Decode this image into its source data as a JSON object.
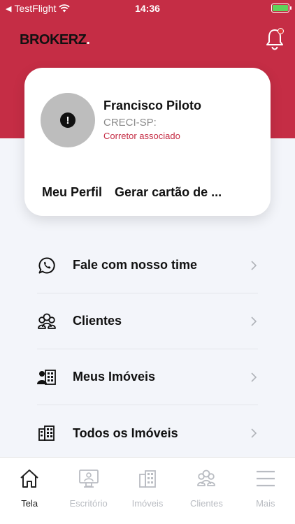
{
  "status_bar": {
    "carrier": "TestFlight",
    "time": "14:36"
  },
  "header": {
    "brand": "BROKERZ",
    "brand_dot": "."
  },
  "profile": {
    "name": "Francisco Piloto",
    "creci": "CRECI-SP:",
    "role": "Corretor associado",
    "actions": [
      "Meu Perfil",
      "Gerar cartão de ..."
    ]
  },
  "menu": {
    "items": [
      {
        "label": "Fale com nosso time",
        "icon": "whatsapp-icon"
      },
      {
        "label": "Clientes",
        "icon": "users-icon"
      },
      {
        "label": "Meus Imóveis",
        "icon": "user-building-icon"
      },
      {
        "label": "Todos os Imóveis",
        "icon": "building-icon"
      }
    ]
  },
  "tabbar": {
    "tabs": [
      {
        "label": "Tela",
        "icon": "home-icon",
        "active": true
      },
      {
        "label": "Escritório",
        "icon": "monitor-user-icon",
        "active": false
      },
      {
        "label": "Imóveis",
        "icon": "building-icon",
        "active": false
      },
      {
        "label": "Clientes",
        "icon": "users-icon",
        "active": false
      },
      {
        "label": "Mais",
        "icon": "hamburger-icon",
        "active": false
      }
    ]
  },
  "colors": {
    "brand": "#c52d45",
    "background": "#f3f5fa",
    "inactive_tab": "#b9bcc2"
  }
}
